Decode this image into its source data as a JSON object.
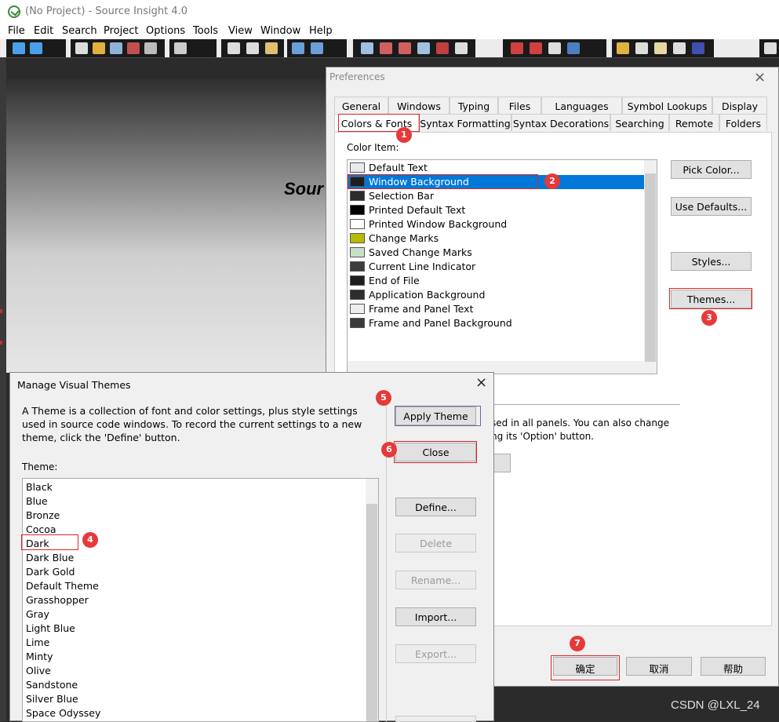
{
  "app": {
    "title": "(No Project) - Source Insight 4.0",
    "menu": [
      "File",
      "Edit",
      "Search",
      "Project",
      "Options",
      "Tools",
      "View",
      "Window",
      "Help"
    ],
    "splash_text": "Sour"
  },
  "preferences": {
    "title": "Preferences",
    "close_glyph": "×",
    "tabs_row1": [
      "General",
      "Windows",
      "Typing",
      "Files",
      "Languages",
      "Symbol Lookups",
      "Display"
    ],
    "tabs_row2": [
      "Colors & Fonts",
      "Syntax Formatting",
      "Syntax Decorations",
      "Searching",
      "Remote",
      "Folders"
    ],
    "active_tab": "Colors & Fonts",
    "color_item_label": "Color Item:",
    "color_items": [
      {
        "label": "Default Text",
        "swatch": "#e9e9ee"
      },
      {
        "label": "Window Background",
        "swatch": "#1e1e1e",
        "selected": true
      },
      {
        "label": "Selection Bar",
        "swatch": "#2b2b2b"
      },
      {
        "label": "Printed Default Text",
        "swatch": "#000000"
      },
      {
        "label": "Printed Window Background",
        "swatch": "#ffffff"
      },
      {
        "label": "Change Marks",
        "swatch": "#b9b900"
      },
      {
        "label": "Saved Change Marks",
        "swatch": "#c8e0c8"
      },
      {
        "label": "Current Line Indicator",
        "swatch": "#3c3c3c"
      },
      {
        "label": "End of File",
        "swatch": "#1e1e1e"
      },
      {
        "label": "Application Background",
        "swatch": "#2d2d2d"
      },
      {
        "label": "Frame and Panel Text",
        "swatch": "#eeeeee"
      },
      {
        "label": "Frame and Panel Background",
        "swatch": "#3a3a3a"
      }
    ],
    "buttons": {
      "pick_color": "Pick Color...",
      "use_defaults": "Use Defaults...",
      "styles": "Styles...",
      "themes": "Themes..."
    },
    "partial_text_1": "sed in all panels. You can also change",
    "partial_text_2": "ng its 'Option' button.",
    "ok": "确定",
    "cancel": "取消",
    "help": "帮助"
  },
  "themes_dialog": {
    "title": "Manage Visual Themes",
    "close_glyph": "×",
    "description": "A Theme is a collection of font and color settings, plus style settings used in source code windows. To record the current settings to a new theme, click the 'Define' button.",
    "theme_label": "Theme:",
    "themes": [
      "Black",
      "Blue",
      "Bronze",
      "Cocoa",
      "Dark",
      "Dark Blue",
      "Dark Gold",
      "Default Theme",
      "Grasshopper",
      "Gray",
      "Light Blue",
      "Lime",
      "Minty",
      "Olive",
      "Sandstone",
      "Silver Blue",
      "Space Odyssey"
    ],
    "buttons": {
      "apply_theme": "Apply Theme",
      "close": "Close",
      "define": "Define...",
      "delete": "Delete",
      "rename": "Rename...",
      "import": "Import...",
      "export": "Export..."
    }
  },
  "annotations": [
    "1",
    "2",
    "3",
    "4",
    "5",
    "6",
    "7"
  ],
  "watermark": "CSDN @LXL_24"
}
